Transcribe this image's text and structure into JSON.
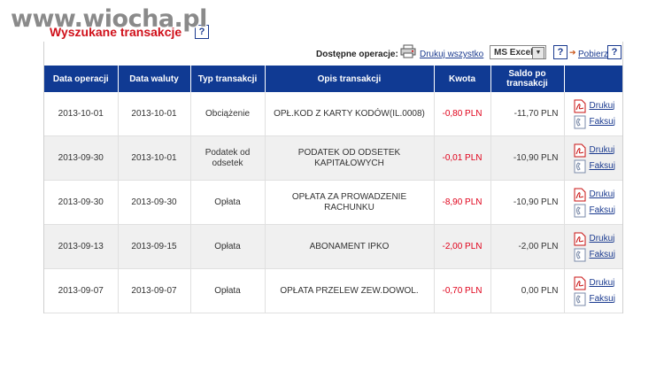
{
  "watermark": "www.wiocha.pl",
  "title": "Wyszukane transakcje",
  "help_label": "?",
  "toolbar": {
    "available_label": "Dostępne operacje:",
    "print_all": "Drukuj wszystko",
    "format_selected": "MS Excel",
    "download": "Pobierz"
  },
  "columns": [
    "Data operacji",
    "Data waluty",
    "Typ transakcji",
    "Opis transakcji",
    "Kwota",
    "Saldo po transakcji"
  ],
  "rows": [
    {
      "op_date": "2013-10-01",
      "val_date": "2013-10-01",
      "type": "Obciążenie",
      "desc": "OPŁ.KOD Z KARTY KODÓW(IL.0008)",
      "amount": "-0,80 PLN",
      "balance": "-11,70 PLN"
    },
    {
      "op_date": "2013-09-30",
      "val_date": "2013-10-01",
      "type": "Podatek od odsetek",
      "desc": "PODATEK OD ODSETEK KAPITAŁOWYCH",
      "amount": "-0,01 PLN",
      "balance": "-10,90 PLN"
    },
    {
      "op_date": "2013-09-30",
      "val_date": "2013-09-30",
      "type": "Opłata",
      "desc": "OPŁATA ZA PROWADZENIE RACHUNKU",
      "amount": "-8,90 PLN",
      "balance": "-10,90 PLN"
    },
    {
      "op_date": "2013-09-13",
      "val_date": "2013-09-15",
      "type": "Opłata",
      "desc": "ABONAMENT IPKO",
      "amount": "-2,00 PLN",
      "balance": "-2,00 PLN"
    },
    {
      "op_date": "2013-09-07",
      "val_date": "2013-09-07",
      "type": "Opłata",
      "desc": "OPŁATA PRZELEW ZEW.DOWOL.",
      "amount": "-0,70 PLN",
      "balance": "0,00 PLN"
    }
  ],
  "actions": {
    "print": "Drukuj",
    "fax": "Faksuj"
  },
  "colors": {
    "header_bg": "#103a93",
    "title_red": "#d0101a",
    "amount_red": "#e0001a",
    "link_blue": "#1a3a8f"
  },
  "icons": {
    "print_all": "printer-icon",
    "print": "pdf-icon",
    "fax": "fax-icon",
    "download": "arrow-right-icon"
  }
}
